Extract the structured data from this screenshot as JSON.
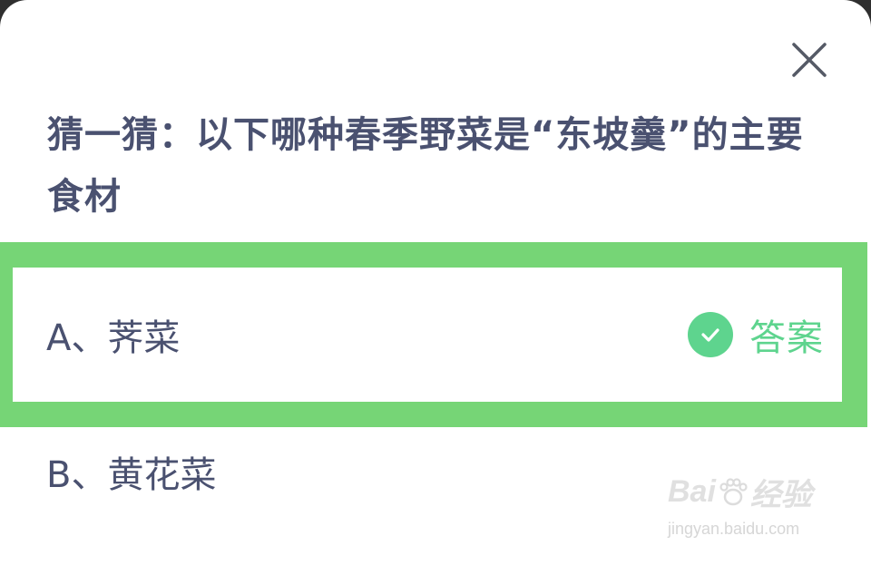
{
  "question": {
    "title": "猜一猜：以下哪种春季野菜是“东坡羹”的主要食材"
  },
  "options": [
    {
      "label": "A、荠菜",
      "is_answer": true
    },
    {
      "label": "B、黄花菜",
      "is_answer": false
    }
  ],
  "answer_tag": {
    "text": "答案",
    "icon": "check-icon"
  },
  "close": {
    "icon": "close-icon"
  },
  "watermark": {
    "brand_prefix": "Bai",
    "brand_suffix": "经验",
    "url": "jingyan.baidu.com"
  },
  "colors": {
    "highlight": "#76d576",
    "answer": "#5ed48e",
    "text": "#4a5170"
  }
}
